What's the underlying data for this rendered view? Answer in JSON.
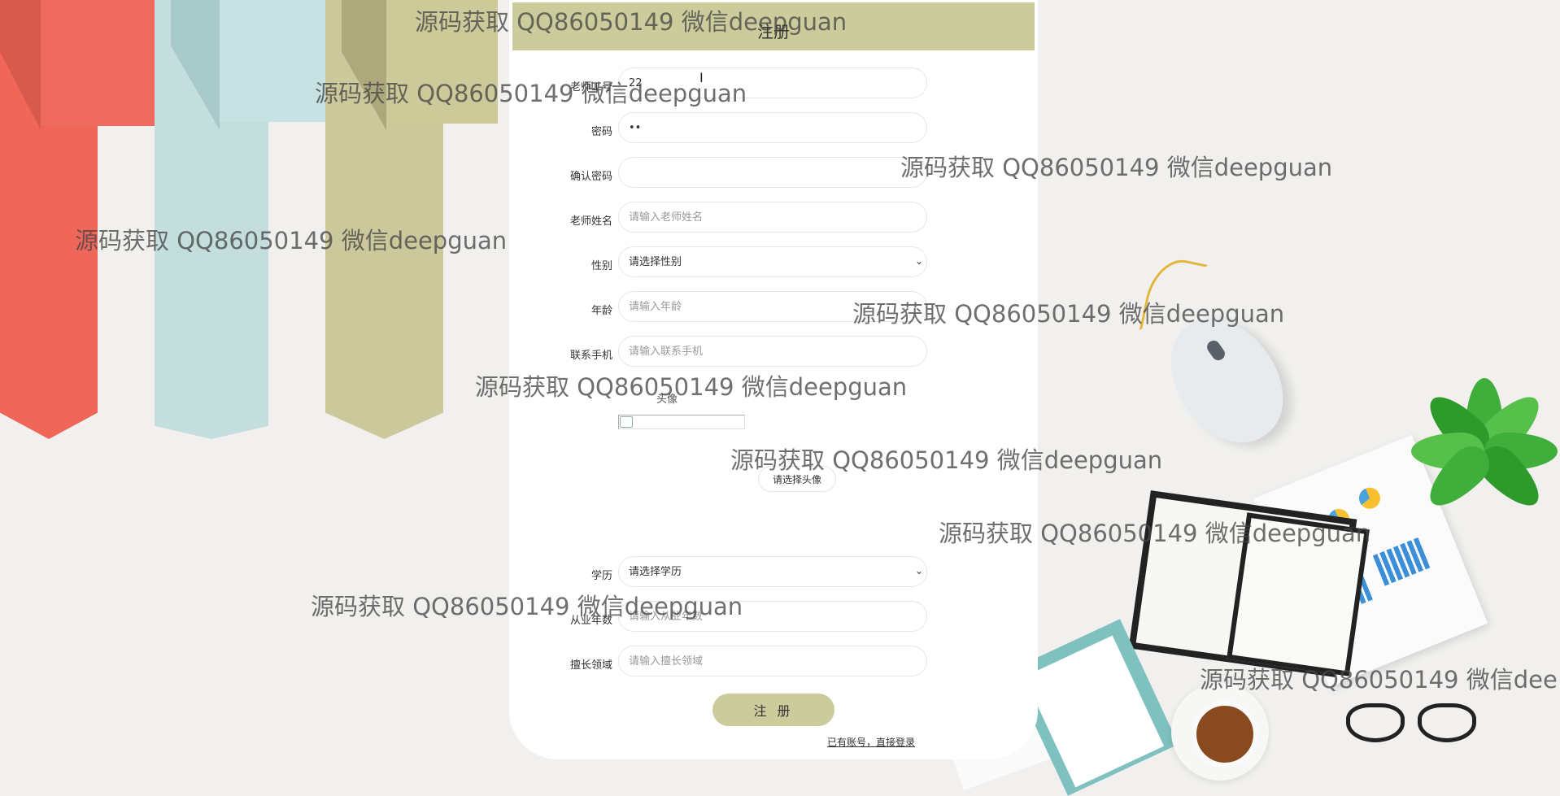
{
  "form": {
    "title": "注册",
    "account": {
      "label": "老师工号",
      "value": "22"
    },
    "password": {
      "label": "密码",
      "value": "••"
    },
    "confirm_password": {
      "label": "确认密码",
      "value": ""
    },
    "teacher_name": {
      "label": "老师姓名",
      "placeholder": "请输入老师姓名"
    },
    "gender": {
      "label": "性别",
      "selected": "请选择性别"
    },
    "age": {
      "label": "年龄",
      "placeholder": "请输入年龄"
    },
    "phone": {
      "label": "联系手机",
      "placeholder": "请输入联系手机"
    },
    "avatar": {
      "label": "头像",
      "button": "请选择头像"
    },
    "education": {
      "label": "学历",
      "selected": "请选择学历"
    },
    "years": {
      "label": "从业年数",
      "placeholder": "请输入从业年数"
    },
    "specialty": {
      "label": "擅长领域",
      "placeholder": "请输入擅长领域"
    },
    "submit": "注 册",
    "login_link": "已有账号，直接登录"
  },
  "watermark_text": "源码获取 QQ86050149 微信deepguan",
  "watermark_text_cut": "源码获取 QQ86050149 微信dee",
  "colors": {
    "accent": "#cbcb9c",
    "ribbon_red": "#f0675a",
    "ribbon_blue": "#c4dedd",
    "ribbon_olive": "#cbc99c"
  }
}
